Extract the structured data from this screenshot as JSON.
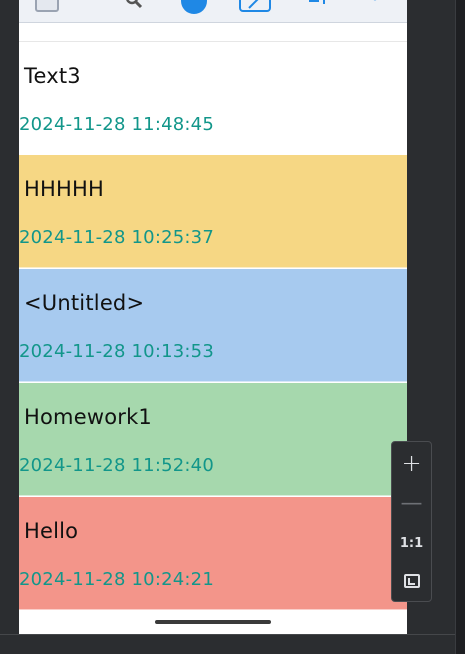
{
  "toolbar": {
    "icons": [
      "notes-list-icon",
      "search-icon",
      "color-dot-icon",
      "edit-icon",
      "sort-icon",
      "more-vert-icon"
    ],
    "accent": "#1f88e5"
  },
  "notes": [
    {
      "title": "Text3",
      "timestamp": "2024-11-28 11:48:45",
      "color": "#ffffff"
    },
    {
      "title": "HHHHH",
      "timestamp": "2024-11-28 10:25:37",
      "color": "#f6d784"
    },
    {
      "title": "<Untitled>",
      "timestamp": "2024-11-28 10:13:53",
      "color": "#a7caef"
    },
    {
      "title": "Homework1",
      "timestamp": "2024-11-28 11:52:40",
      "color": "#a6d8ad"
    },
    {
      "title": "Hello",
      "timestamp": "2024-11-28 10:24:21",
      "color": "#f3958a"
    }
  ],
  "timestamp_color": "#12968a",
  "zoom_controls": {
    "zoom_in": "+",
    "zoom_out": "—",
    "actual_size": "1:1"
  }
}
